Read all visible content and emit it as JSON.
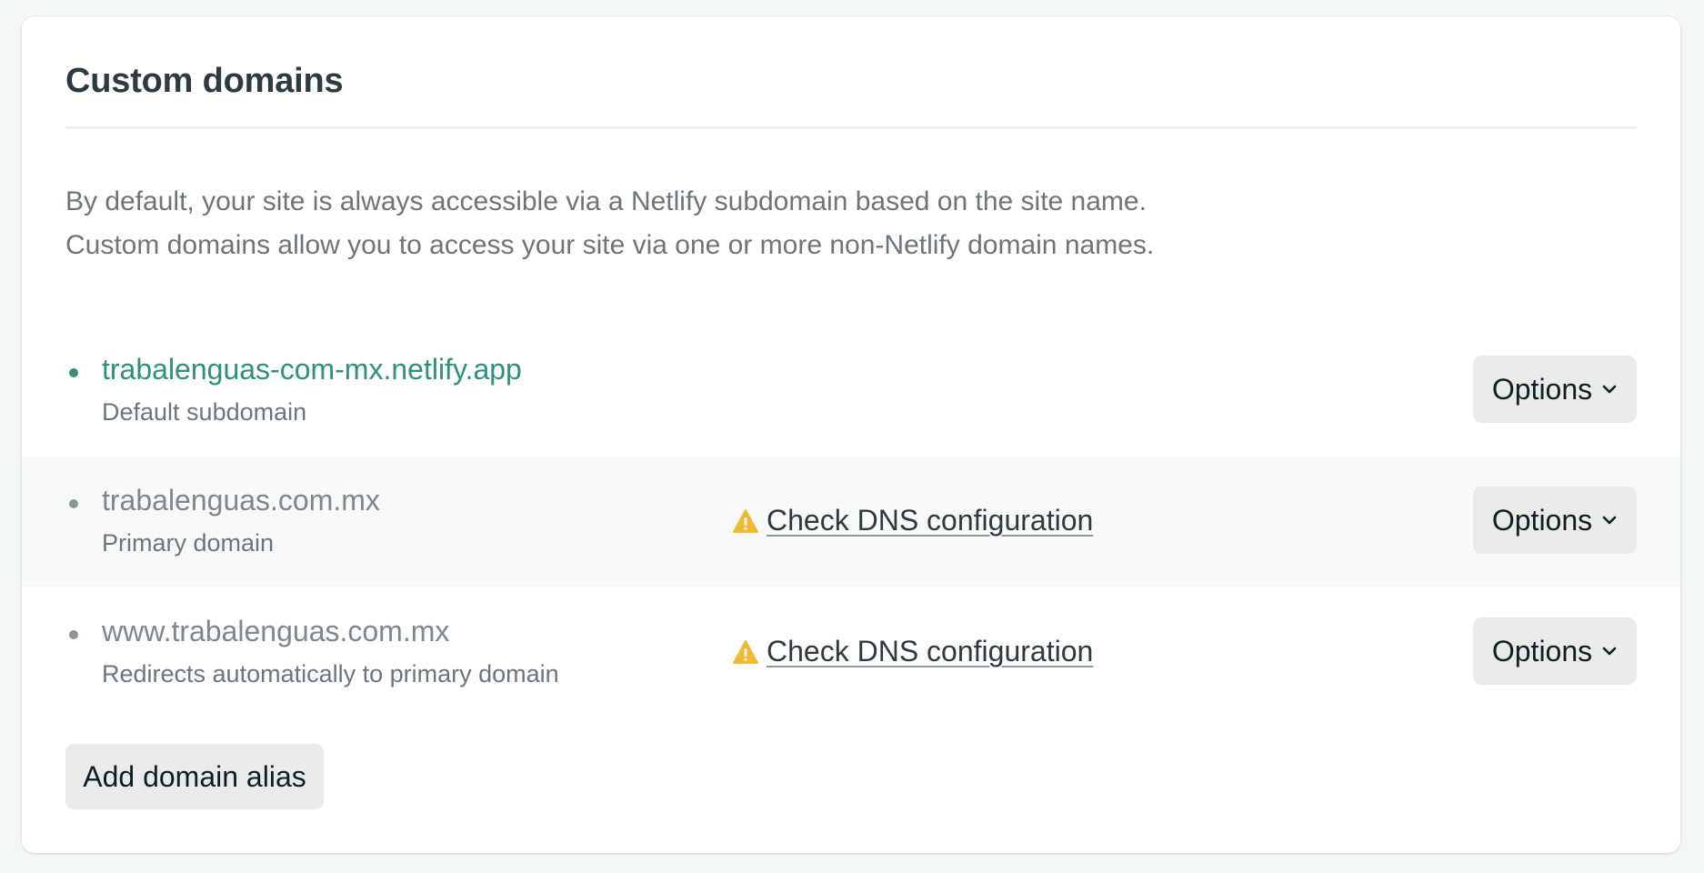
{
  "section": {
    "title": "Custom domains",
    "description_line1": "By default, your site is always accessible via a Netlify subdomain based on the site name.",
    "description_line2": "Custom domains allow you to access your site via one or more non-Netlify domain names."
  },
  "domains": [
    {
      "name": "trabalenguas-com-mx.netlify.app",
      "subtitle": "Default subdomain",
      "options_label": "Options"
    },
    {
      "name": "trabalenguas.com.mx",
      "subtitle": "Primary domain",
      "warning": "Check DNS configuration",
      "options_label": "Options"
    },
    {
      "name": "www.trabalenguas.com.mx",
      "subtitle": "Redirects automatically to primary domain",
      "warning": "Check DNS configuration",
      "options_label": "Options"
    }
  ],
  "actions": {
    "add_alias_label": "Add domain alias"
  },
  "colors": {
    "accent_teal": "#30907f",
    "warning_yellow": "#f2b933",
    "button_bg": "#e9ebeb",
    "text_dark": "#2d3b41",
    "text_muted": "#6a767c"
  },
  "icons": {
    "warning": "warning-triangle-icon",
    "dropdown": "chevron-down-icon",
    "bullet": "bullet-dot"
  }
}
